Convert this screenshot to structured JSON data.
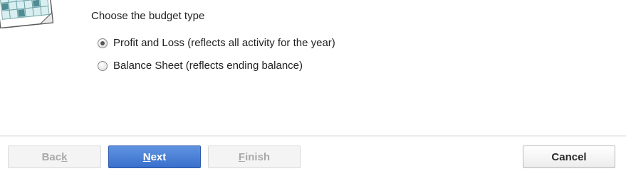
{
  "header_art": {
    "icon": "calendar-icon"
  },
  "budget_type": {
    "prompt": "Choose the budget type",
    "options": [
      {
        "label": "Profit and Loss (reflects all activity for the year)",
        "selected": true
      },
      {
        "label": "Balance Sheet (reflects ending balance)",
        "selected": false
      }
    ]
  },
  "buttons": {
    "back": {
      "pre": "Bac",
      "ul": "k",
      "post": "",
      "enabled": false
    },
    "next": {
      "pre": "",
      "ul": "N",
      "post": "ext",
      "enabled": true
    },
    "finish": {
      "pre": "",
      "ul": "F",
      "post": "inish",
      "enabled": false
    },
    "cancel": {
      "label": "Cancel",
      "enabled": true
    }
  },
  "colors": {
    "primary_button": "#3a70cc",
    "disabled_text": "#a9a9a9"
  }
}
